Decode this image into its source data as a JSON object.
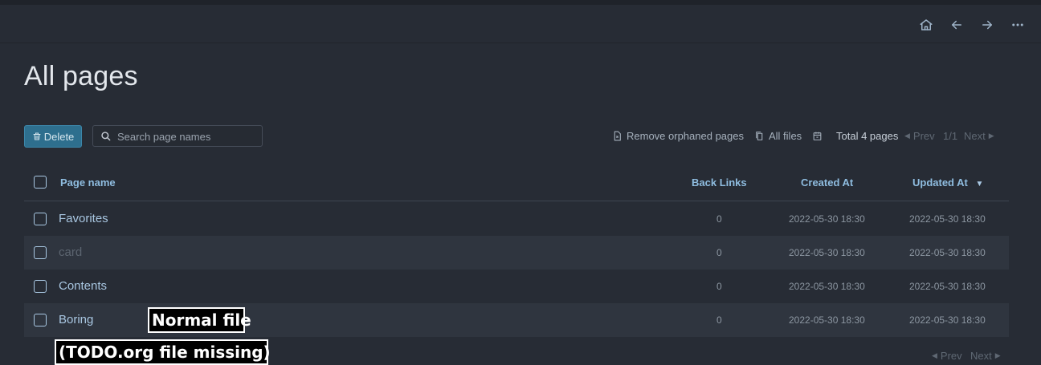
{
  "header": {
    "home_icon": "home-icon",
    "back_icon": "arrow-left-icon",
    "forward_icon": "arrow-right-icon",
    "more_icon": "more-horizontal-icon"
  },
  "page": {
    "title": "All pages"
  },
  "toolbar": {
    "delete_label": "Delete",
    "search_placeholder": "Search page names",
    "remove_orphaned_label": "Remove orphaned pages",
    "all_files_label": "All files",
    "total_label": "Total 4 pages",
    "prev_label": "Prev",
    "page_indicator": "1/1",
    "next_label": "Next"
  },
  "table": {
    "columns": {
      "page_name": "Page name",
      "back_links": "Back Links",
      "created_at": "Created At",
      "updated_at": "Updated At"
    },
    "rows": [
      {
        "name": "Favorites",
        "back_links": "0",
        "created_at": "2022-05-30 18:30",
        "updated_at": "2022-05-30 18:30"
      },
      {
        "name": "card",
        "back_links": "0",
        "created_at": "2022-05-30 18:30",
        "updated_at": "2022-05-30 18:30"
      },
      {
        "name": "Contents",
        "back_links": "0",
        "created_at": "2022-05-30 18:30",
        "updated_at": "2022-05-30 18:30"
      },
      {
        "name": "Boring",
        "back_links": "0",
        "created_at": "2022-05-30 18:30",
        "updated_at": "2022-05-30 18:30"
      }
    ]
  },
  "annotations": {
    "normal_file": "Normal file",
    "todo_missing": "(TODO.org file missing)"
  },
  "bottom_pager": {
    "prev_label": "Prev",
    "next_label": "Next"
  },
  "colors": {
    "accent": "#2e6f8e",
    "link": "#a9c7e2",
    "header_text": "#8fbde0",
    "background": "#272c35"
  }
}
